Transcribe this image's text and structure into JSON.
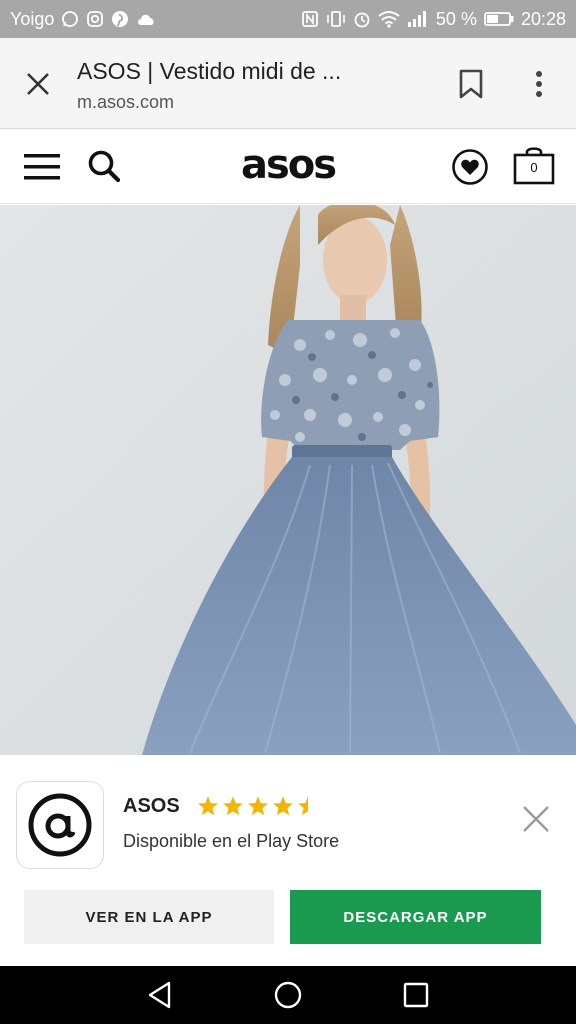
{
  "status_bar": {
    "carrier": "Yoigo",
    "battery": "50 %",
    "time": "20:28"
  },
  "browser": {
    "title": "ASOS | Vestido midi de ...",
    "url": "m.asos.com"
  },
  "site_header": {
    "logo": "asos",
    "bag_count": "0"
  },
  "app_banner": {
    "app_name": "ASOS",
    "rating": 4.5,
    "description": "Disponible en el Play Store",
    "open_label": "VER EN LA APP",
    "download_label": "DESCARGAR APP",
    "download_color": "#1a9a4f"
  }
}
